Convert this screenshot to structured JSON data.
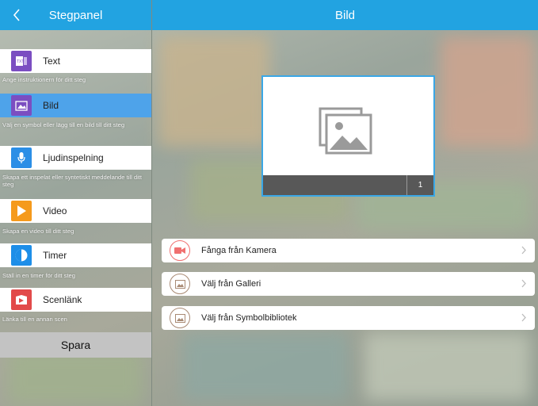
{
  "sidebar": {
    "title": "Stegpanel",
    "items": [
      {
        "label": "Text",
        "icon": "text-file-icon",
        "color": "#7b4ec1",
        "desc": "Ange instruktionern för ditt steg"
      },
      {
        "label": "Bild",
        "icon": "image-icon",
        "color": "#7b4ec1",
        "desc": "Välj en symbol eller lägg till en bild till ditt steg",
        "active": true
      },
      {
        "label": "Ljudinspelning",
        "icon": "microphone-icon",
        "color": "#2b8ee6",
        "desc": "Skapa ett inspelat eller syntetiskt meddelande till ditt steg"
      },
      {
        "label": "Video",
        "icon": "play-icon",
        "color": "#f59a1c",
        "desc": "Skapa en video till ditt steg"
      },
      {
        "label": "Timer",
        "icon": "timer-icon",
        "color": "#1d8ee8",
        "desc": "Ställ in en timer för ditt steg"
      },
      {
        "label": "Scenlänk",
        "icon": "scene-link-icon",
        "color": "#e24a4a",
        "desc": "Länka till en annan scen"
      }
    ],
    "save_label": "Spara"
  },
  "main": {
    "title": "Bild",
    "preview": {
      "page_number": "1"
    },
    "options": [
      {
        "label": "Fånga från Kamera",
        "icon": "camera-icon",
        "color": "#f07070"
      },
      {
        "label": "Välj från Galleri",
        "icon": "gallery-icon",
        "color": "#a98a74"
      },
      {
        "label": "Välj från Symbolbibliotek",
        "icon": "symbol-library-icon",
        "color": "#a98a74"
      }
    ]
  },
  "colors": {
    "accent": "#22a3e1",
    "active": "#4ea3ea"
  }
}
